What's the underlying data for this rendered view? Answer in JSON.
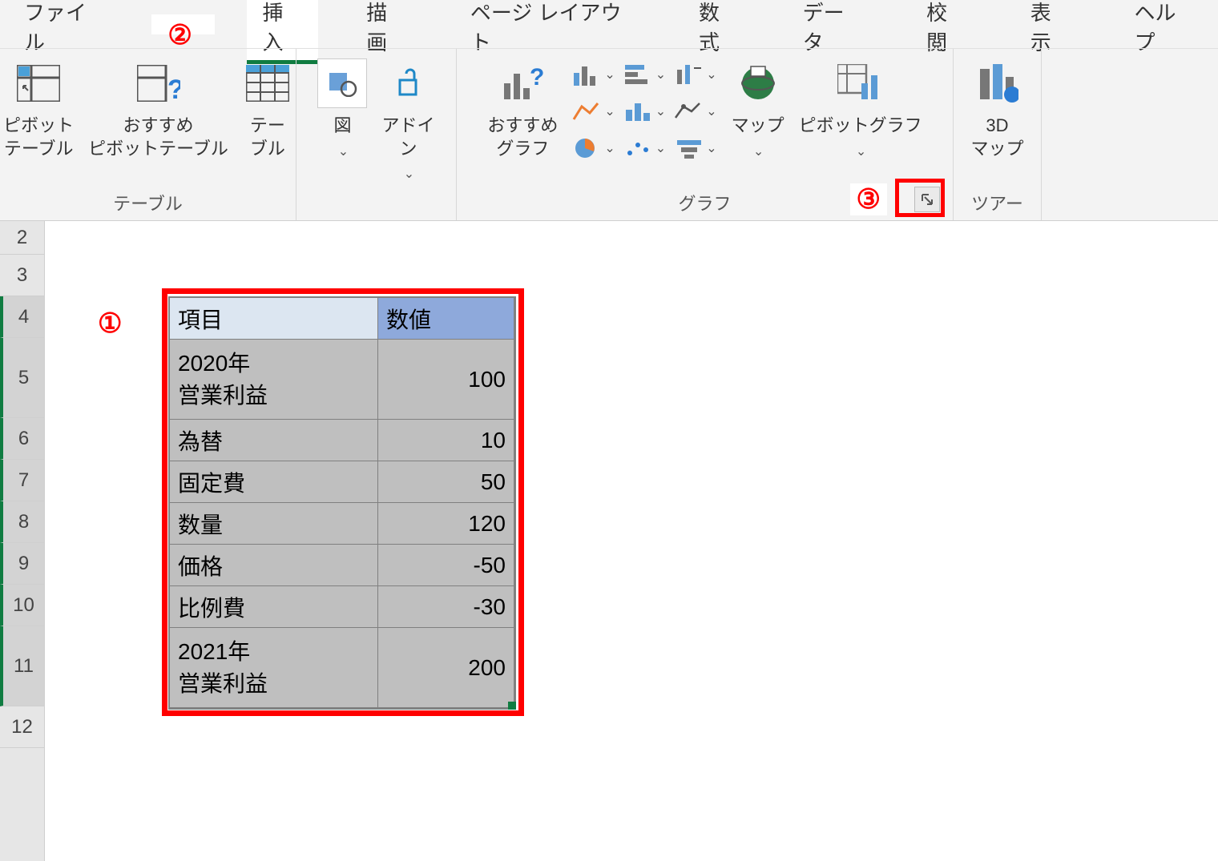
{
  "ribbon": {
    "tabs": [
      "ファイル",
      "",
      "挿入",
      "描画",
      "ページ レイアウト",
      "数式",
      "データ",
      "校閲",
      "表示",
      "ヘルプ"
    ],
    "group_tables": {
      "label": "テーブル",
      "pivot": "ピボット\nテーブル",
      "recommended_pivot": "おすすめ\nピボットテーブル",
      "table": "テーブル"
    },
    "group_illustrations": {
      "shapes": "図",
      "addins": "アドイ\nン"
    },
    "group_charts": {
      "label": "グラフ",
      "recommended": "おすすめ\nグラフ",
      "map": "マップ",
      "pivot_chart": "ピボットグラフ"
    },
    "group_tours": {
      "label": "ツアー",
      "3dmap": "3D\nマップ"
    }
  },
  "annotations": {
    "a1": "①",
    "a2": "②",
    "a3": "③"
  },
  "rows": [
    "2",
    "3",
    "4",
    "5",
    "6",
    "7",
    "8",
    "9",
    "10",
    "11",
    "12"
  ],
  "data_table": {
    "headers": [
      "項目",
      "数値"
    ],
    "rows": [
      {
        "label": "2020年\n営業利益",
        "value": "100",
        "multi": true
      },
      {
        "label": "為替",
        "value": "10",
        "multi": false
      },
      {
        "label": "固定費",
        "value": "50",
        "multi": false
      },
      {
        "label": "数量",
        "value": "120",
        "multi": false
      },
      {
        "label": "価格",
        "value": "-50",
        "multi": false
      },
      {
        "label": "比例費",
        "value": "-30",
        "multi": false
      },
      {
        "label": "2021年\n営業利益",
        "value": "200",
        "multi": true
      }
    ]
  },
  "chart_data": {
    "type": "table",
    "headers": [
      "項目",
      "数値"
    ],
    "rows": [
      [
        "2020年 営業利益",
        100
      ],
      [
        "為替",
        10
      ],
      [
        "固定費",
        50
      ],
      [
        "数量",
        120
      ],
      [
        "価格",
        -50
      ],
      [
        "比例費",
        -30
      ],
      [
        "2021年 営業利益",
        200
      ]
    ]
  }
}
